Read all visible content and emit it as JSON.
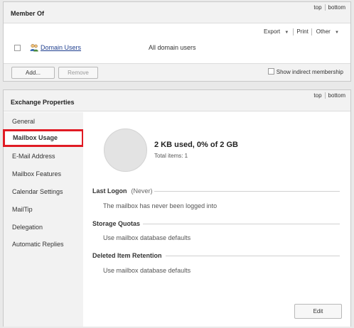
{
  "member_of": {
    "title": "Member Of",
    "top_link": "top",
    "bottom_link": "bottom",
    "toolbar": {
      "export": "Export",
      "print": "Print",
      "other": "Other"
    },
    "members": [
      {
        "name": "Domain Users",
        "description": "All domain users"
      }
    ],
    "add_label": "Add...",
    "remove_label": "Remove",
    "show_indirect_label": "Show indirect membership"
  },
  "exchange": {
    "title": "Exchange Properties",
    "top_link": "top",
    "bottom_link": "bottom",
    "nav": [
      "General",
      "Mailbox Usage",
      "E-Mail Address",
      "Mailbox Features",
      "Calendar Settings",
      "MailTip",
      "Delegation",
      "Automatic Replies"
    ],
    "active_nav": "Mailbox Usage",
    "usage": {
      "summary": "2 KB used, 0% of 2 GB",
      "total_items": "Total items: 1",
      "percent_used": 0
    },
    "last_logon": {
      "label": "Last Logon",
      "status": "(Never)",
      "value": "The mailbox has never been logged into"
    },
    "storage_quotas": {
      "label": "Storage Quotas",
      "value": "Use mailbox database defaults"
    },
    "deleted_item_retention": {
      "label": "Deleted Item Retention",
      "value": "Use mailbox database defaults"
    },
    "edit_label": "Edit"
  },
  "colors": {
    "highlight": "#e01b24",
    "link": "#1f3f8f",
    "panel_header": "#f2f2f2"
  }
}
